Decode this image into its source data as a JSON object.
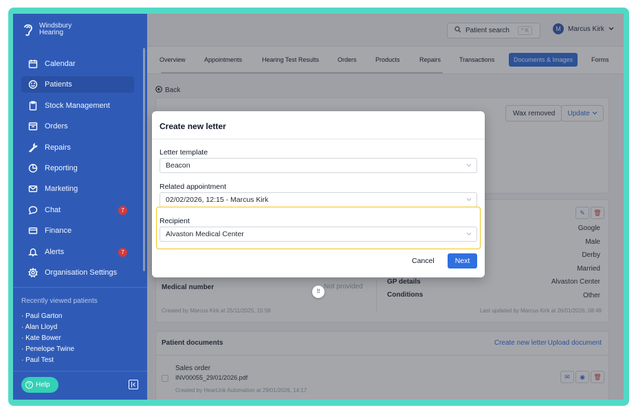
{
  "brand": {
    "name_line1": "Windsbury",
    "name_line2": "Hearing"
  },
  "sidebar": {
    "items": [
      {
        "label": "Calendar",
        "icon": "calendar-icon"
      },
      {
        "label": "Patients",
        "icon": "smiley-icon",
        "active": true
      },
      {
        "label": "Stock Management",
        "icon": "clipboard-icon"
      },
      {
        "label": "Orders",
        "icon": "box-icon"
      },
      {
        "label": "Repairs",
        "icon": "wrench-icon"
      },
      {
        "label": "Reporting",
        "icon": "pie-chart-icon"
      },
      {
        "label": "Marketing",
        "icon": "mail-icon"
      },
      {
        "label": "Chat",
        "icon": "chat-icon",
        "badge": "7"
      },
      {
        "label": "Finance",
        "icon": "credit-card-icon"
      },
      {
        "label": "Alerts",
        "icon": "bell-icon",
        "badge": "7"
      },
      {
        "label": "Organisation Settings",
        "icon": "gear-icon"
      }
    ],
    "recent_title": "Recently viewed patients",
    "recent": [
      "Paul Garton",
      "Alan Lloyd",
      "Kate Bower",
      "Penelope Twine",
      "Paul Test"
    ],
    "help_label": "Help"
  },
  "topbar": {
    "search_label": "Patient search",
    "search_shortcut": "^ K",
    "user_initial": "M",
    "user_name": "Marcus Kirk"
  },
  "tabs": [
    "Overview",
    "Appointments",
    "Hearing Test Results",
    "Orders",
    "Products",
    "Repairs",
    "Transactions",
    "Documents & Images",
    "Forms"
  ],
  "active_tab": "Documents & Images",
  "page": {
    "back_label": "Back",
    "wax_removed_label": "Wax removed",
    "update_label": "Update",
    "details_right": [
      "Google",
      "Male",
      "Derby",
      "Married",
      "Alvaston Center",
      "Other"
    ],
    "medical_number_label": "Medical number",
    "medical_number_value": "Not provided",
    "gp_details_label": "GP details",
    "conditions_label": "Conditions",
    "created_by": "Created by Marcus Kirk at 25/11/2025, 15:58",
    "last_updated": "Last updated by Marcus Kirk at 26/01/2026, 08:49",
    "documents_title": "Patient documents",
    "create_letter_link": "Create new letter",
    "upload_link": "Upload document",
    "doc_title": "Sales order",
    "doc_file": "INV00055_29/01/2026.pdf",
    "doc_created": "Created by HearLink Automation at 29/01/2026, 14:17"
  },
  "modal": {
    "title": "Create new letter",
    "template_label": "Letter template",
    "template_value": "Beacon",
    "appointment_label": "Related appointment",
    "appointment_value": "02/02/2026, 12:15 - Marcus Kirk",
    "recipient_label": "Recipient",
    "recipient_value": "Alvaston Medical Center",
    "cancel_label": "Cancel",
    "next_label": "Next"
  },
  "colors": {
    "sidebar": "#2f5bb7",
    "accent": "#2f6fe0",
    "frame": "#52d9c6",
    "highlight": "#f3c515",
    "badge": "#d63a3a"
  }
}
